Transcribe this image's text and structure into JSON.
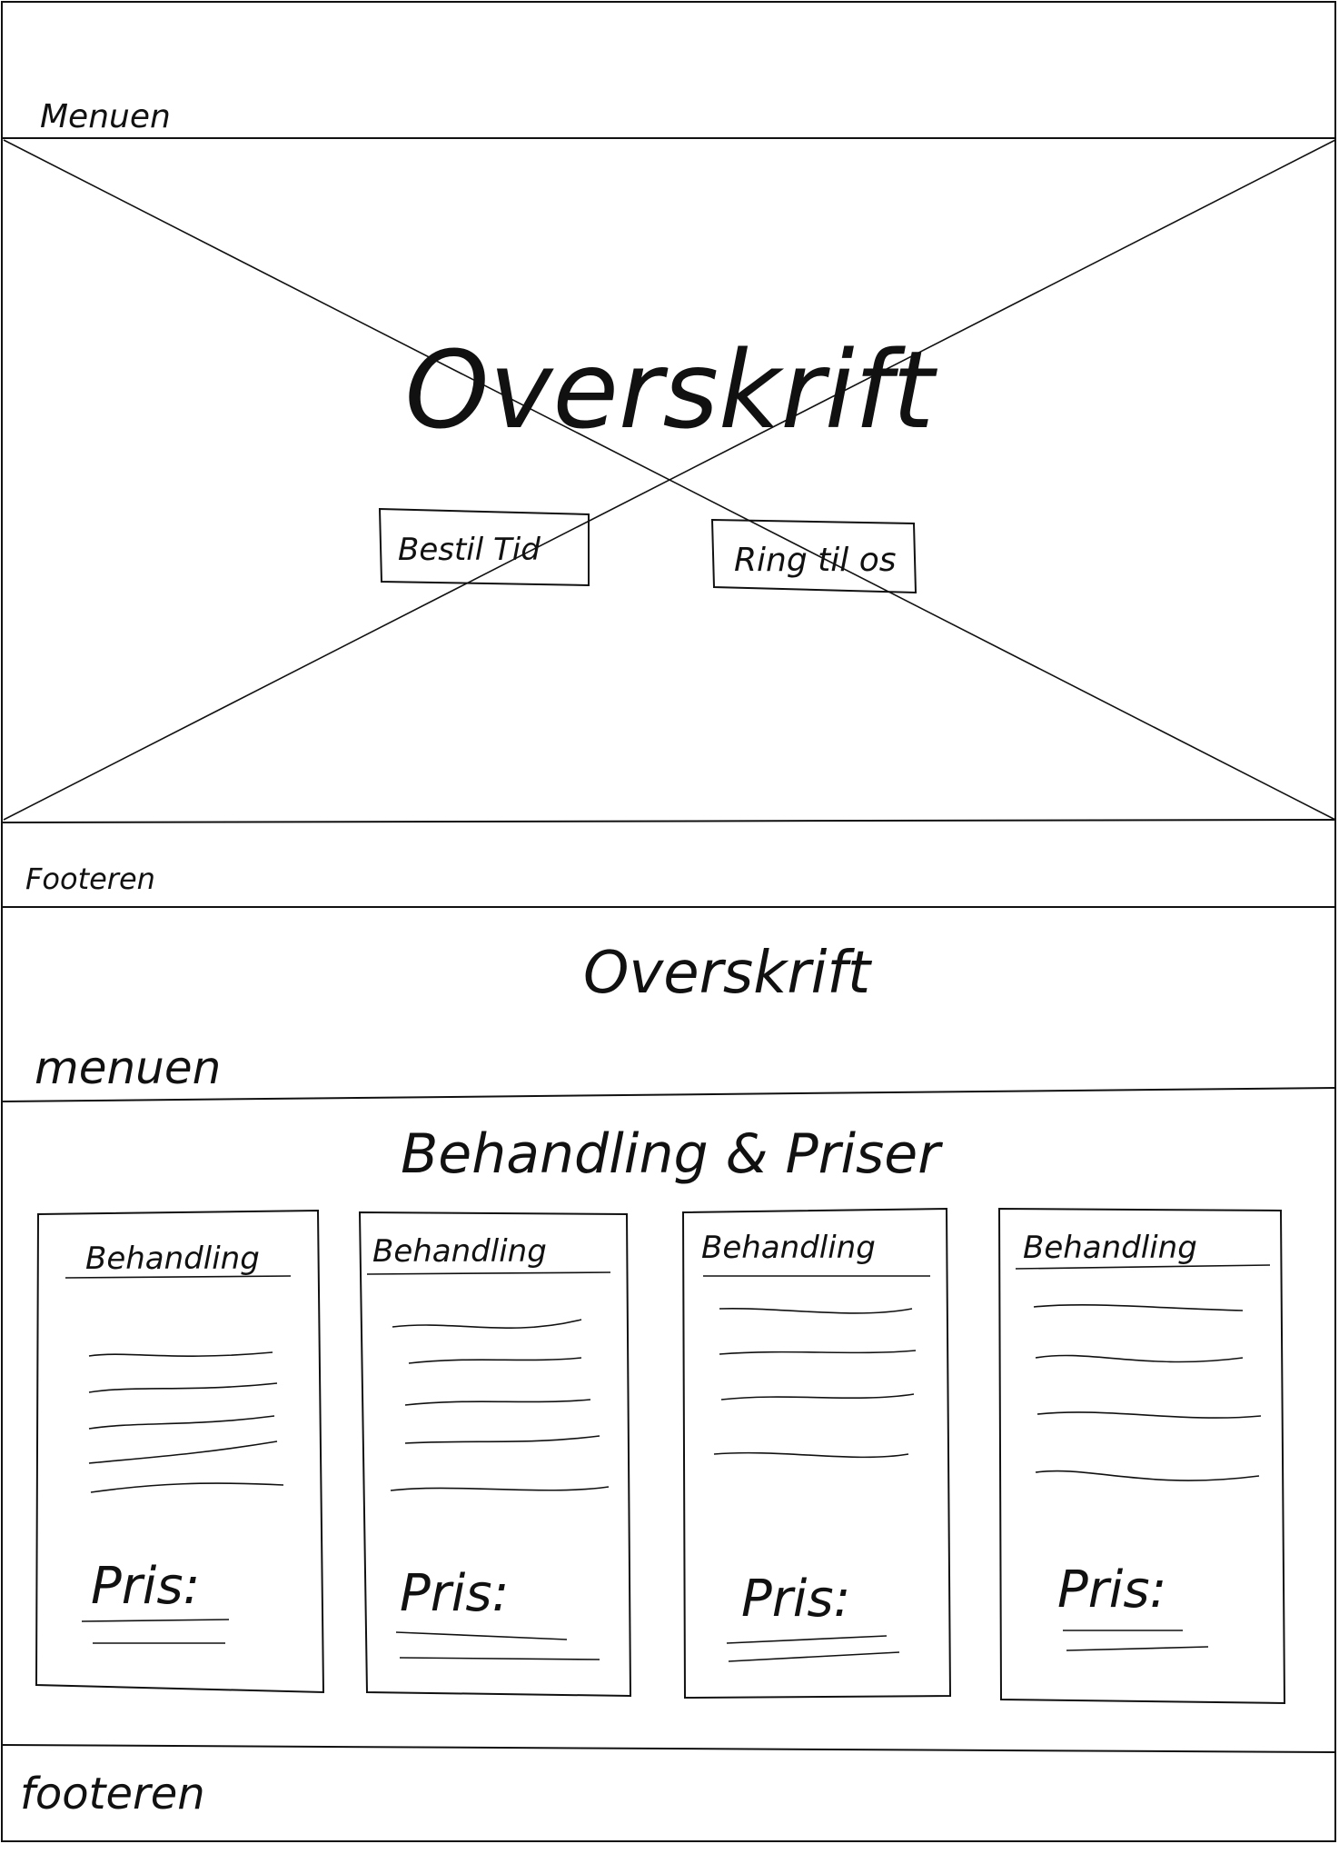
{
  "page1": {
    "menu_label": "Menuen",
    "hero_title": "Overskrift",
    "book_button": "Bestil Tid",
    "call_button": "Ring til os",
    "footer_label": "Footeren"
  },
  "page2": {
    "header_title": "Overskrift",
    "menu_label": "menuen",
    "section_title": "Behandling & Priser",
    "cards": [
      {
        "title": "Behandling",
        "price_label": "Pris:"
      },
      {
        "title": "Behandling",
        "price_label": "Pris:"
      },
      {
        "title": "Behandling",
        "price_label": "Pris:"
      },
      {
        "title": "Behandling",
        "price_label": "Pris:"
      }
    ],
    "footer_label": "footeren"
  }
}
